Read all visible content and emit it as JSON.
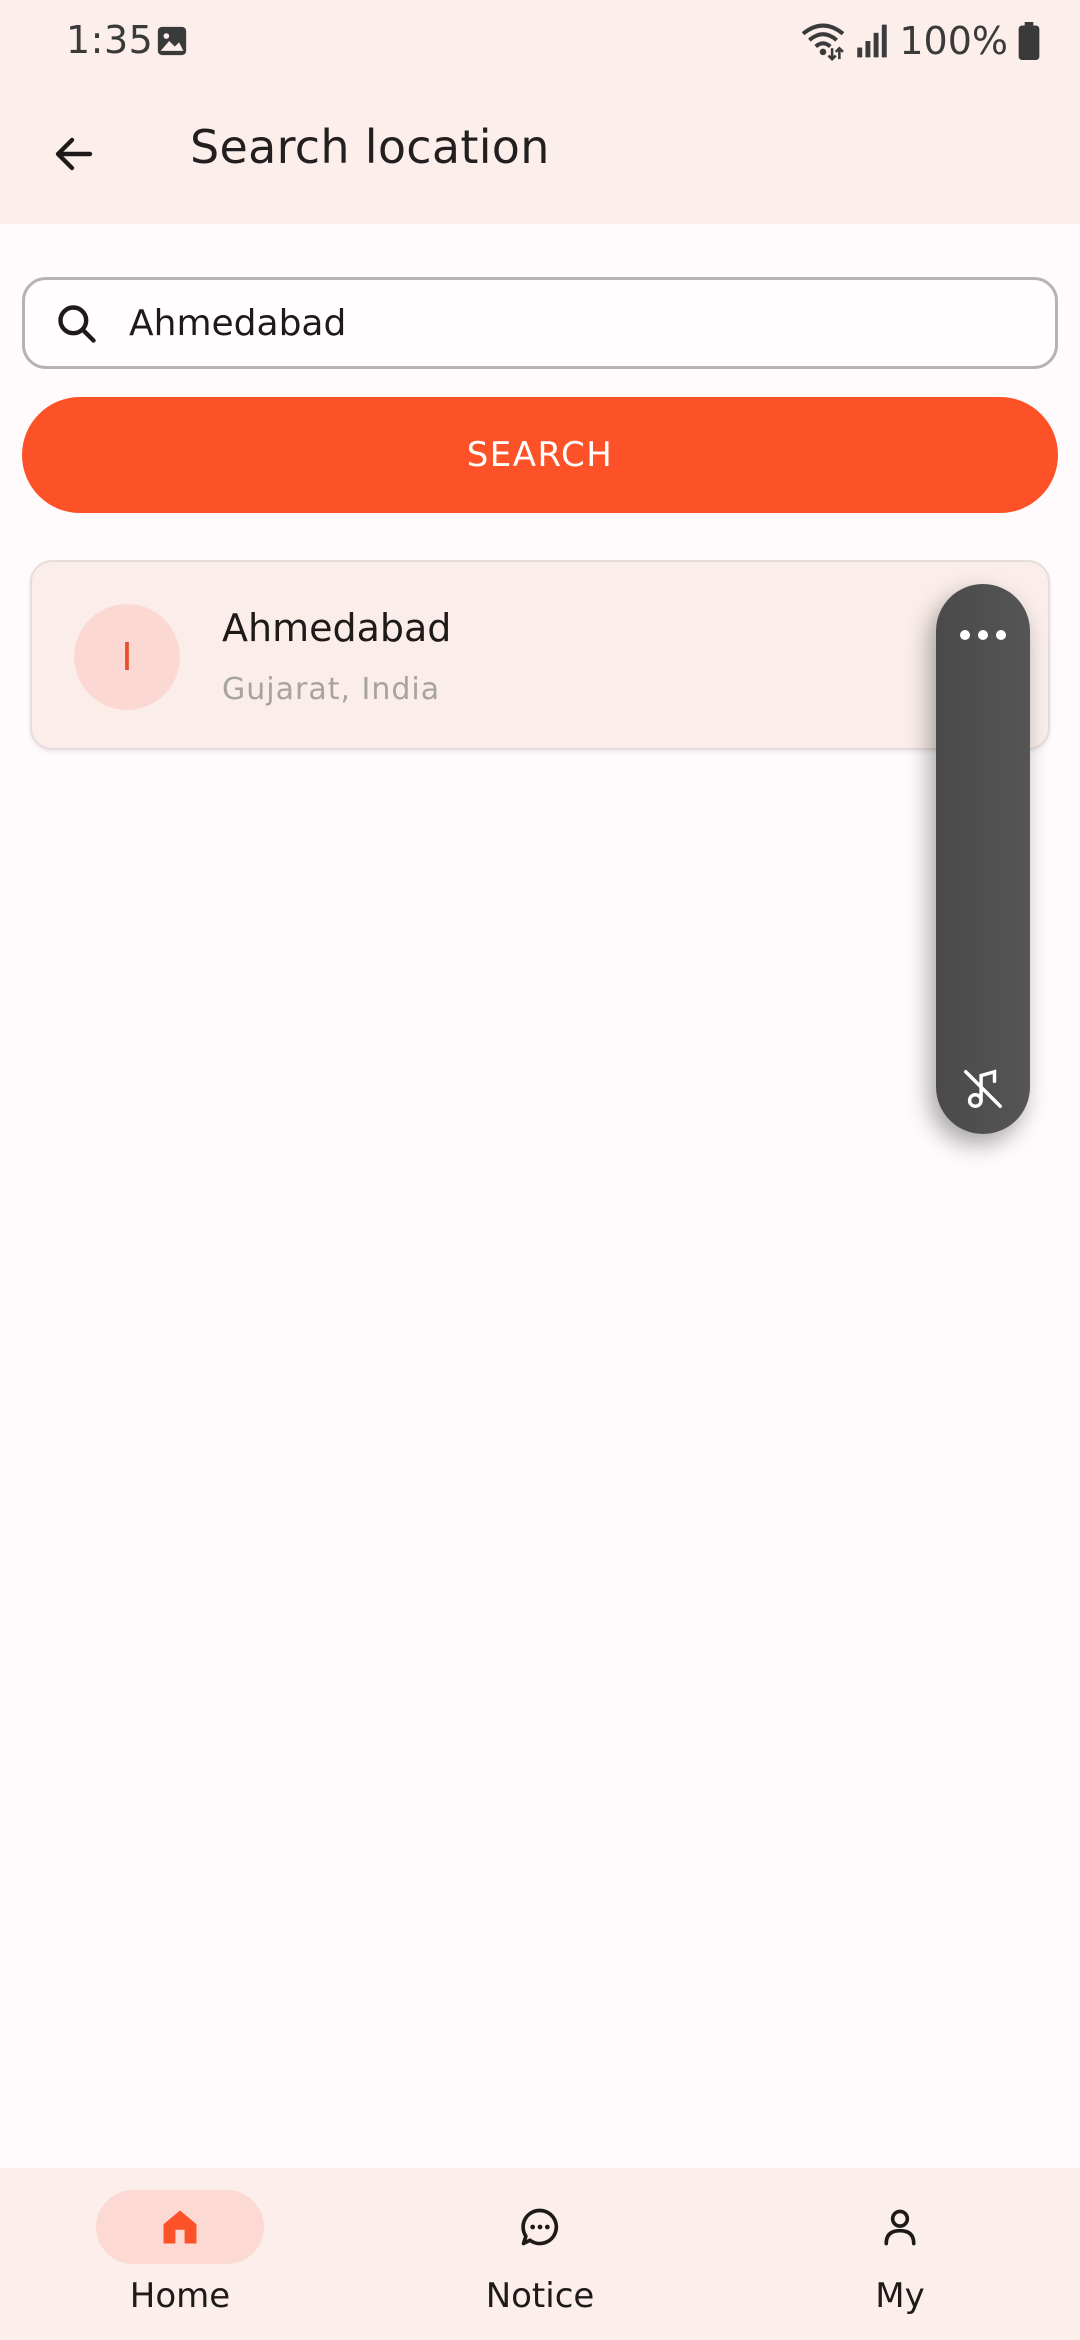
{
  "status_bar": {
    "time": "1:35",
    "battery": "100%",
    "icons": [
      "image-icon",
      "wifi-icon",
      "signal-icon",
      "battery-icon"
    ]
  },
  "app_bar": {
    "title": "Search location",
    "back_icon": "arrow-left-icon"
  },
  "search": {
    "value": "Ahmedabad",
    "button_label": "SEARCH",
    "icon": "search-icon"
  },
  "results": [
    {
      "avatar_letter": "I",
      "name": "Ahmedabad",
      "subtitle": "Gujarat, India"
    }
  ],
  "floating_widget": {
    "icons": [
      "more-horizontal-icon",
      "music-off-icon"
    ]
  },
  "bottom_nav": {
    "items": [
      {
        "label": "Home",
        "icon": "home-icon",
        "active": true
      },
      {
        "label": "Notice",
        "icon": "chat-bubble-icon",
        "active": false
      },
      {
        "label": "My",
        "icon": "person-icon",
        "active": false
      }
    ]
  },
  "colors": {
    "accent": "#fd5128",
    "surface": "#fcefeb",
    "background": "#fffbfd",
    "active_pill": "#fdd9d3",
    "widget": "#4e4e4e"
  }
}
